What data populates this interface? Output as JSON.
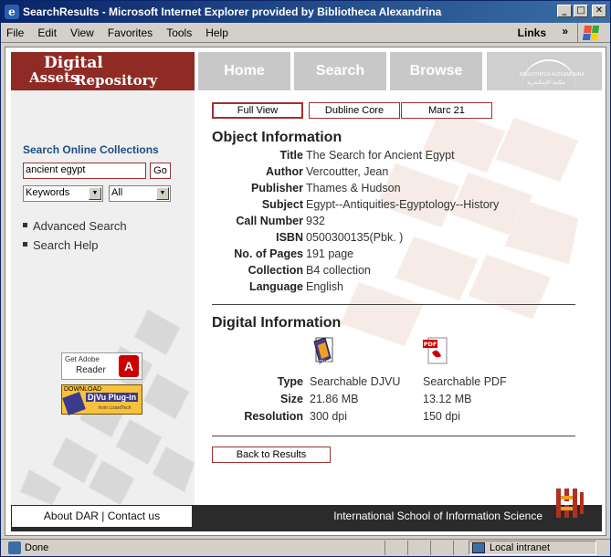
{
  "window": {
    "title": "SearchResults - Microsoft Internet Explorer provided by Bibliotheca Alexandrina",
    "buttons": {
      "minimize": "_",
      "maximize": "□",
      "close": "✕"
    }
  },
  "menubar": {
    "items": [
      "File",
      "Edit",
      "View",
      "Favorites",
      "Tools",
      "Help"
    ],
    "links_label": "Links",
    "chevron": "»"
  },
  "header": {
    "logo_line1": "Digital",
    "logo_line2": "Assets",
    "logo_line3": "Repository",
    "nav": [
      "Home",
      "Search",
      "Browse"
    ],
    "bibalex_text": "BIBLIOTHECA ALEXANDRINA",
    "bibalex_text_ar": "مكتبة الإسكندرية"
  },
  "sidebar": {
    "title": "Search Online Collections",
    "search_value": "ancient egypt",
    "go_label": "Go",
    "field_select": "Keywords",
    "scope_select": "All",
    "links": [
      "Advanced Search",
      "Search Help"
    ],
    "adobe_line1": "Get Adobe",
    "adobe_line2": "Reader",
    "djvu_line1": "DOWNLOAD",
    "djvu_line2": "DjVu Plug-in",
    "djvu_line3": "from LizardTech"
  },
  "view_tabs": [
    "Full View",
    "Dubline Core",
    "Marc 21"
  ],
  "object_info": {
    "heading": "Object Information",
    "rows": [
      {
        "label": "Title",
        "value": "The Search for Ancient Egypt"
      },
      {
        "label": "Author",
        "value": "Vercoutter, Jean"
      },
      {
        "label": "Publisher",
        "value": "Thames & Hudson"
      },
      {
        "label": "Subject",
        "value": "Egypt--Antiquities-Egyptology--History"
      },
      {
        "label": "Call Number",
        "value": "932"
      },
      {
        "label": "ISBN",
        "value": "0500300135(Pbk. )"
      },
      {
        "label": "No. of Pages",
        "value": "191 page"
      },
      {
        "label": "Collection",
        "value": "B4 collection"
      },
      {
        "label": "Language",
        "value": "English"
      }
    ]
  },
  "digital_info": {
    "heading": "Digital Information",
    "djvu_icon_text": "DjVu",
    "pdf_icon_text": "PDF",
    "rows": [
      {
        "label": "Type",
        "djvu": "Searchable DJVU",
        "pdf": "Searchable PDF"
      },
      {
        "label": "Size",
        "djvu": "21.86 MB",
        "pdf": "13.12 MB"
      },
      {
        "label": "Resolution",
        "djvu": "300 dpi",
        "pdf": "150 dpi"
      }
    ]
  },
  "back_button": "Back to Results",
  "footer": {
    "left": "About DAR | Contact us",
    "right": "International School of Information Science"
  },
  "statusbar": {
    "status": "Done",
    "zone": "Local intranet"
  }
}
